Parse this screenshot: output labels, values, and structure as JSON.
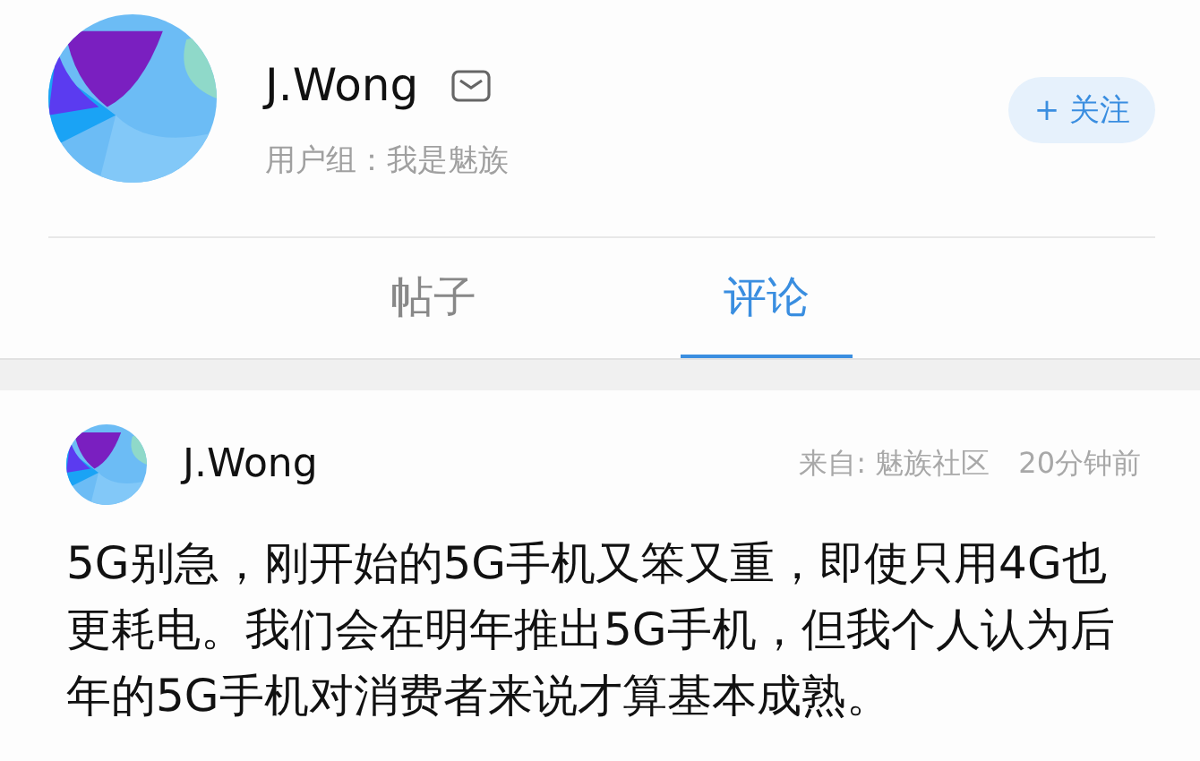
{
  "profile": {
    "name": "J.Wong",
    "group": "用户组：我是魅族",
    "follow_button": "+ 关注"
  },
  "tabs": [
    {
      "label": "帖子",
      "selected": false
    },
    {
      "label": "评论",
      "selected": true
    }
  ],
  "comments": [
    {
      "author": "J.Wong",
      "source": "来自: 魅族社区",
      "time": "20分钟前",
      "body": "5G别急，刚开始的5G手机又笨又重，即使只用4G也更耗电。我们会在明年推出5G手机，但我个人认为后年的5G手机对消费者来说才算基本成熟。"
    }
  ]
}
